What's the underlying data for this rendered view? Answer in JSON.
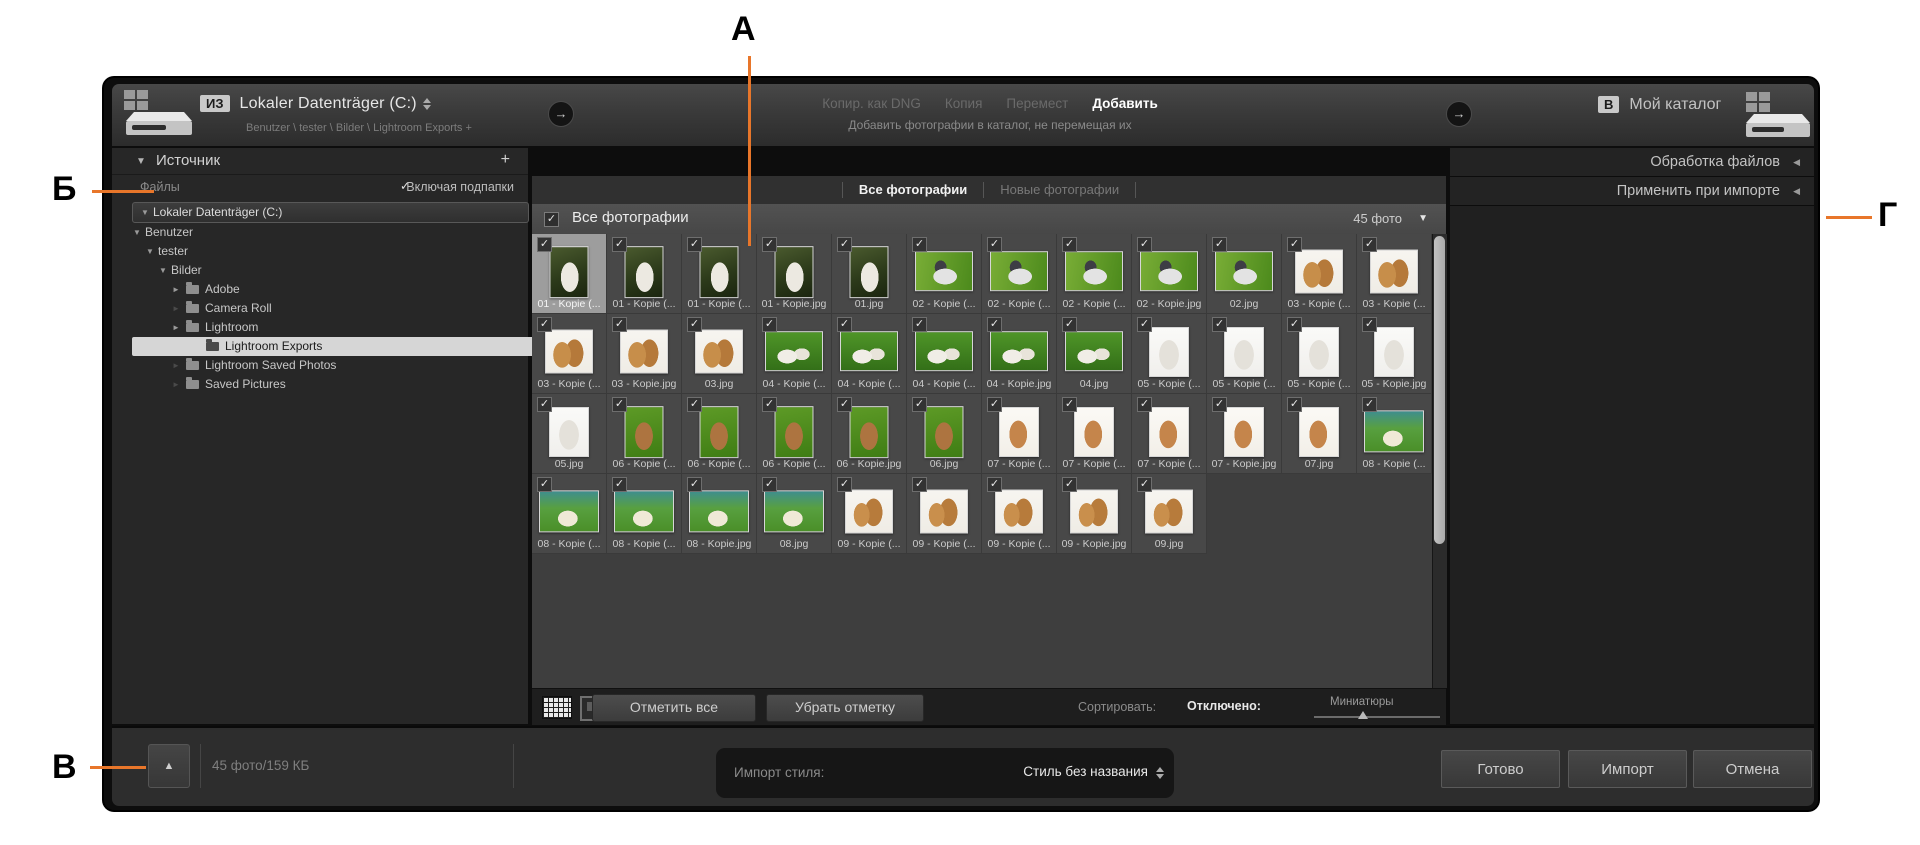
{
  "annotations": {
    "a": "А",
    "b": "Б",
    "v": "В",
    "g": "Г"
  },
  "header": {
    "from_badge": "ИЗ",
    "from_title": "Lokaler Datenträger (C:)",
    "from_path": "Benutzer \\ tester \\ Bilder \\ Lightroom Exports +",
    "actions": [
      {
        "label": "Копир. как DNG",
        "active": false
      },
      {
        "label": "Копия",
        "active": false
      },
      {
        "label": "Перемест",
        "active": false
      },
      {
        "label": "Добавить",
        "active": true
      }
    ],
    "subtitle": "Добавить фотографии в каталог, не перемещая их",
    "to_badge": "В",
    "to_title": "Мой каталог"
  },
  "source_panel": {
    "title": "Источник",
    "add_button": "+",
    "files_label": "Файлы",
    "include_subfolders": "Включая подпапки",
    "tree": [
      {
        "label": "Lokaler Datenträger (C:)",
        "indent": 0,
        "arrow": "▼",
        "boxed": true
      },
      {
        "label": "Benutzer",
        "indent": 1,
        "arrow": "▼"
      },
      {
        "label": "tester",
        "indent": 2,
        "arrow": "▼"
      },
      {
        "label": "Bilder",
        "indent": 3,
        "arrow": "▼"
      },
      {
        "label": "Adobe",
        "indent": 4,
        "arrow": "►",
        "folder": true
      },
      {
        "label": "Camera Roll",
        "indent": 4,
        "arrow": "►",
        "dim": true,
        "folder": true
      },
      {
        "label": "Lightroom",
        "indent": 4,
        "arrow": "►",
        "folder": true
      },
      {
        "label": "Lightroom Exports",
        "indent": 4,
        "folder": true,
        "selected": true
      },
      {
        "label": "Lightroom Saved Photos",
        "indent": 4,
        "arrow": "►",
        "dim": true,
        "folder": true
      },
      {
        "label": "Saved Pictures",
        "indent": 4,
        "arrow": "►",
        "dim": true,
        "folder": true
      }
    ]
  },
  "content": {
    "tabs": [
      {
        "label": "Все фотографии",
        "active": true
      },
      {
        "label": "Новые фотографии",
        "active": false
      }
    ],
    "section_title": "Все фотографии",
    "photo_count": "45 фото",
    "photos": [
      {
        "label": "01 - Kopie (...",
        "series": "01",
        "selected": true
      },
      {
        "label": "01 - Kopie (...",
        "series": "01"
      },
      {
        "label": "01 - Kopie (...",
        "series": "01"
      },
      {
        "label": "01 - Kopie.jpg",
        "series": "01"
      },
      {
        "label": "01.jpg",
        "series": "01"
      },
      {
        "label": "02 - Kopie (...",
        "series": "02"
      },
      {
        "label": "02 - Kopie (...",
        "series": "02"
      },
      {
        "label": "02 - Kopie (...",
        "series": "02"
      },
      {
        "label": "02 - Kopie.jpg",
        "series": "02"
      },
      {
        "label": "02.jpg",
        "series": "02"
      },
      {
        "label": "03 - Kopie (...",
        "series": "03"
      },
      {
        "label": "03 - Kopie (...",
        "series": "03"
      },
      {
        "label": "03 - Kopie (...",
        "series": "03"
      },
      {
        "label": "03 - Kopie.jpg",
        "series": "03"
      },
      {
        "label": "03.jpg",
        "series": "03"
      },
      {
        "label": "04 - Kopie (...",
        "series": "04"
      },
      {
        "label": "04 - Kopie (...",
        "series": "04"
      },
      {
        "label": "04 - Kopie (...",
        "series": "04"
      },
      {
        "label": "04 - Kopie.jpg",
        "series": "04"
      },
      {
        "label": "04.jpg",
        "series": "04"
      },
      {
        "label": "05 - Kopie (...",
        "series": "05"
      },
      {
        "label": "05 - Kopie (...",
        "series": "05"
      },
      {
        "label": "05 - Kopie (...",
        "series": "05"
      },
      {
        "label": "05 - Kopie.jpg",
        "series": "05"
      },
      {
        "label": "05.jpg",
        "series": "05"
      },
      {
        "label": "06 - Kopie (...",
        "series": "06"
      },
      {
        "label": "06 - Kopie (...",
        "series": "06"
      },
      {
        "label": "06 - Kopie (...",
        "series": "06"
      },
      {
        "label": "06 - Kopie.jpg",
        "series": "06"
      },
      {
        "label": "06.jpg",
        "series": "06"
      },
      {
        "label": "07 - Kopie (...",
        "series": "07"
      },
      {
        "label": "07 - Kopie (...",
        "series": "07"
      },
      {
        "label": "07 - Kopie (...",
        "series": "07"
      },
      {
        "label": "07 - Kopie.jpg",
        "series": "07"
      },
      {
        "label": "07.jpg",
        "series": "07"
      },
      {
        "label": "08 - Kopie (...",
        "series": "08"
      },
      {
        "label": "08 - Kopie (...",
        "series": "08"
      },
      {
        "label": "08 - Kopie (...",
        "series": "08"
      },
      {
        "label": "08 - Kopie.jpg",
        "series": "08"
      },
      {
        "label": "08.jpg",
        "series": "08"
      },
      {
        "label": "09 - Kopie (...",
        "series": "09"
      },
      {
        "label": "09 - Kopie (...",
        "series": "09"
      },
      {
        "label": "09 - Kopie (...",
        "series": "09"
      },
      {
        "label": "09 - Kopie.jpg",
        "series": "09"
      },
      {
        "label": "09.jpg",
        "series": "09"
      }
    ]
  },
  "grid_toolbar": {
    "check_all": "Отметить все",
    "uncheck_all": "Убрать отметку",
    "sort_label": "Сортировать:",
    "sort_value": "Отключено:",
    "thumbs_label": "Миниатюры"
  },
  "right_panel": {
    "sections": [
      "Обработка файлов",
      "Применить при импорте"
    ]
  },
  "bottom_bar": {
    "status": "45 фото/159 КБ",
    "preset_label": "Импорт стиля:",
    "preset_value": "Стиль без названия",
    "buttons": [
      "Готово",
      "Импорт",
      "Отмена"
    ]
  },
  "colors": {
    "annotation_line": "#e8762a",
    "accent_selection": "#d6d6d6"
  }
}
